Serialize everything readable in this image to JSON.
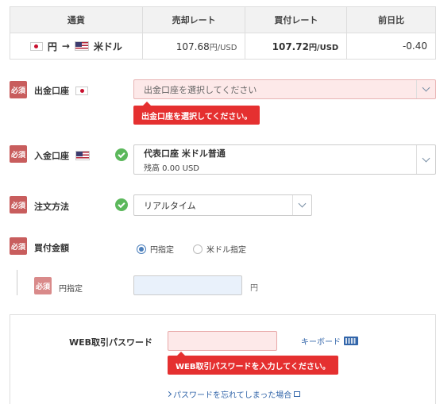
{
  "rate_table": {
    "headers": [
      "通貨",
      "売却レート",
      "買付レート",
      "前日比"
    ],
    "pair": {
      "from": "円",
      "arrow": "→",
      "to": "米ドル"
    },
    "sell_rate": "107.68",
    "sell_unit": "円/USD",
    "buy_rate": "107.72",
    "buy_unit": "円/USD",
    "change": "-0.40"
  },
  "required_badge": "必須",
  "withdraw": {
    "label": "出金口座",
    "placeholder": "出金口座を選択してください",
    "error": "出金口座を選択してください。"
  },
  "deposit": {
    "label": "入金口座",
    "account_name": "代表口座 米ドル普通",
    "balance": "残高 0.00 USD"
  },
  "order_method": {
    "label": "注文方法",
    "value": "リアルタイム"
  },
  "amount": {
    "label": "買付金額",
    "options": [
      "円指定",
      "米ドル指定"
    ],
    "selected": "円指定",
    "sub_label": "円指定",
    "unit": "円"
  },
  "password": {
    "label": "WEB取引パスワード",
    "keyboard": "キーボード",
    "error": "WEB取引パスワードを入力してください。",
    "forgot": "パスワードを忘れてしまった場合"
  },
  "colors": {
    "required": "#c85d5d",
    "error": "#e53030",
    "check": "#5cb85c",
    "link": "#3366aa"
  }
}
